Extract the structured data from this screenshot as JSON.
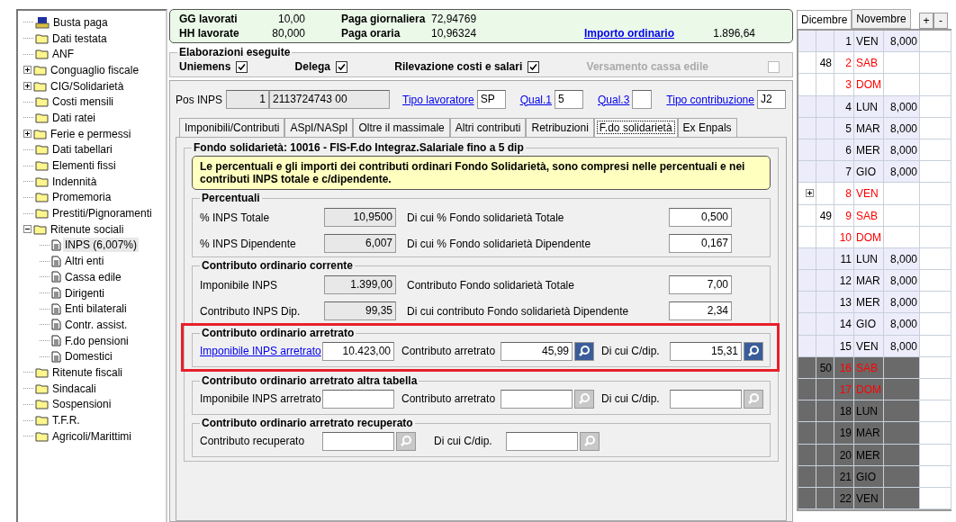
{
  "tree": [
    {
      "label": "Busta paga",
      "kind": "payslip"
    },
    {
      "label": "Dati testata",
      "kind": "folder"
    },
    {
      "label": "ANF",
      "kind": "folder"
    },
    {
      "label": "Conguaglio fiscale",
      "kind": "folder",
      "expanded": false
    },
    {
      "label": "CIG/Solidarietà",
      "kind": "folder",
      "expanded": false
    },
    {
      "label": "Costi mensili",
      "kind": "folder"
    },
    {
      "label": "Dati ratei",
      "kind": "folder"
    },
    {
      "label": "Ferie e permessi",
      "kind": "folder",
      "expanded": false
    },
    {
      "label": "Dati tabellari",
      "kind": "folder"
    },
    {
      "label": "Elementi fissi",
      "kind": "folder"
    },
    {
      "label": "Indennità",
      "kind": "folder"
    },
    {
      "label": "Promemoria",
      "kind": "folder"
    },
    {
      "label": "Prestiti/Pignoramenti",
      "kind": "folder"
    },
    {
      "label": "Ritenute sociali",
      "kind": "folder",
      "expanded": true,
      "children": [
        {
          "label": "INPS (6,007%)",
          "kind": "document",
          "selected": true
        },
        {
          "label": "Altri enti",
          "kind": "document",
          "selected": false
        },
        {
          "label": "Cassa edile",
          "kind": "document",
          "selected": false
        },
        {
          "label": "Dirigenti",
          "kind": "document",
          "selected": false
        },
        {
          "label": "Enti bilaterali",
          "kind": "document",
          "selected": false
        },
        {
          "label": "Contr. assist.",
          "kind": "document",
          "selected": false
        },
        {
          "label": "F.do pensioni",
          "kind": "document",
          "selected": false
        },
        {
          "label": "Domestici",
          "kind": "document",
          "selected": false
        }
      ]
    },
    {
      "label": "Ritenute fiscali",
      "kind": "folder"
    },
    {
      "label": "Sindacali",
      "kind": "folder"
    },
    {
      "label": "Sospensioni",
      "kind": "folder"
    },
    {
      "label": "T.F.R.",
      "kind": "folder"
    },
    {
      "label": "Agricoli/Marittimi",
      "kind": "folder"
    }
  ],
  "summary": {
    "rows": [
      [
        {
          "label": "GG lavorati",
          "value": "10,00"
        },
        {
          "label": "Paga giornaliera",
          "value": "72,94769"
        }
      ],
      [
        {
          "label": "HH lavorate",
          "value": "80,000"
        },
        {
          "label": "Paga oraria",
          "value": "10,96324"
        }
      ]
    ],
    "link": "Importo ordinario",
    "link_value": "1.896,64"
  },
  "elaborazioni": {
    "title": "Elaborazioni eseguite",
    "items": [
      {
        "label": "Uniemens",
        "checked": true,
        "disabled": false
      },
      {
        "label": "Delega",
        "checked": true,
        "disabled": false
      },
      {
        "label": "Rilevazione costi e  salari",
        "checked": true,
        "disabled": false
      },
      {
        "label": "Versamento cassa edile",
        "checked": false,
        "disabled": true
      }
    ]
  },
  "pos_inps": {
    "label": "Pos INPS",
    "number": "1",
    "code": "2113724743 00",
    "fields": [
      {
        "label": "Tipo lavoratore",
        "value": "SP"
      },
      {
        "label": "Qual.1",
        "value": "5"
      },
      {
        "label": "Qual.3"
      },
      {
        "label": "Tipo contribuzione",
        "value": "J2"
      }
    ]
  },
  "tabs": [
    {
      "label": "Imponibili/Contributi",
      "selected": false
    },
    {
      "label": "ASpI/NASpI",
      "selected": false
    },
    {
      "label": "Oltre il massimale",
      "selected": false
    },
    {
      "label": "Altri contributi",
      "selected": false
    },
    {
      "label": "Retribuzioni",
      "selected": false
    },
    {
      "label": "F.do solidarietà",
      "selected": true
    },
    {
      "label": "Ex Enpals",
      "selected": false
    }
  ],
  "fondo": {
    "title": "Fondo solidarietà: 10016 - FIS-F.do Integraz.Salariale fino a 5 dip",
    "notice": "Le percentuali e gli importi dei contributi ordinari Fondo Solidarietà, sono compresi nelle percentuali e nei contributi  INPS totale e c/dipendente.",
    "percentuali": {
      "title": "Percentuali",
      "rows": [
        {
          "label": "% INPS Totale",
          "value": "10,9500",
          "label2": "Di cui % Fondo solidarietà Totale",
          "value2": "0,500"
        },
        {
          "label": "% INPS Dipendente",
          "value": "6,007",
          "label2": "Di cui % Fondo solidarietà Dipendente",
          "value2": "0,167"
        }
      ]
    },
    "corrente": {
      "title": "Contributo ordinario corrente",
      "rows": [
        {
          "label": "Imponibile INPS",
          "value": "1.399,00",
          "label2": "Contributo Fondo solidarietà Totale",
          "value2": "7,00"
        },
        {
          "label": "Contributo INPS Dip.",
          "value": "99,35",
          "label2": "Di cui contributo Fondo solidarietà Dipendente",
          "value2": "2,34"
        }
      ]
    },
    "arretrati": [
      {
        "title": "Contributo ordinario arretrato",
        "highlighted": true,
        "fields": [
          {
            "label": "Imponibile INPS arretrato",
            "value": "10.423,00",
            "link": true
          },
          {
            "label": "Contributo arretrato",
            "value": "45,99",
            "lookup": true,
            "enabled": true
          },
          {
            "label": "Di cui C/dip.",
            "value": "15,31",
            "lookup": true,
            "enabled": true
          }
        ]
      },
      {
        "title": "Contributo ordinario arretrato altra tabella",
        "fields": [
          {
            "label": "Imponibile INPS arretrato"
          },
          {
            "label": "Contributo arretrato",
            "lookup": true,
            "enabled": false
          },
          {
            "label": "Di cui C/dip.",
            "lookup": true,
            "enabled": false
          }
        ]
      },
      {
        "title": "Contributo ordinario arretrato recuperato",
        "fields": [
          {
            "label": "Contributo recuperato",
            "lookup": true,
            "enabled": false
          },
          {
            "label": "Di cui C/dip.",
            "lookup": true,
            "enabled": false
          }
        ]
      }
    ]
  },
  "calendar": {
    "tabs": [
      {
        "label": "Dicembre",
        "selected": true
      },
      {
        "label": "Novembre",
        "selected": false
      }
    ],
    "buttons": [
      "+",
      "-"
    ],
    "rows": [
      {
        "day": "1",
        "dow": "VEN",
        "hours": "8,000",
        "kind": "work"
      },
      {
        "week": "48",
        "day": "2",
        "dow": "SAB",
        "kind": "holiday"
      },
      {
        "day": "3",
        "dow": "DOM",
        "kind": "holiday"
      },
      {
        "day": "4",
        "dow": "LUN",
        "hours": "8,000",
        "kind": "work"
      },
      {
        "day": "5",
        "dow": "MAR",
        "hours": "8,000",
        "kind": "work"
      },
      {
        "day": "6",
        "dow": "MER",
        "hours": "8,000",
        "kind": "work"
      },
      {
        "day": "7",
        "dow": "GIO",
        "hours": "8,000",
        "kind": "work"
      },
      {
        "day": "8",
        "dow": "VEN",
        "kind": "holiday",
        "note": true
      },
      {
        "week": "49",
        "day": "9",
        "dow": "SAB",
        "kind": "holiday"
      },
      {
        "day": "10",
        "dow": "DOM",
        "kind": "holiday"
      },
      {
        "day": "11",
        "dow": "LUN",
        "hours": "8,000",
        "kind": "work"
      },
      {
        "day": "12",
        "dow": "MAR",
        "hours": "8,000",
        "kind": "work"
      },
      {
        "day": "13",
        "dow": "MER",
        "hours": "8,000",
        "kind": "work"
      },
      {
        "day": "14",
        "dow": "GIO",
        "hours": "8,000",
        "kind": "work"
      },
      {
        "day": "15",
        "dow": "VEN",
        "hours": "8,000",
        "kind": "work"
      },
      {
        "week": "50",
        "day": "16",
        "dow": "SAB",
        "kind": "future-holiday"
      },
      {
        "day": "17",
        "dow": "DOM",
        "kind": "future-holiday"
      },
      {
        "day": "18",
        "dow": "LUN",
        "kind": "future"
      },
      {
        "day": "19",
        "dow": "MAR",
        "kind": "future"
      },
      {
        "day": "20",
        "dow": "MER",
        "kind": "future"
      },
      {
        "day": "21",
        "dow": "GIO",
        "kind": "future"
      },
      {
        "day": "22",
        "dow": "VEN",
        "kind": "future"
      }
    ]
  }
}
